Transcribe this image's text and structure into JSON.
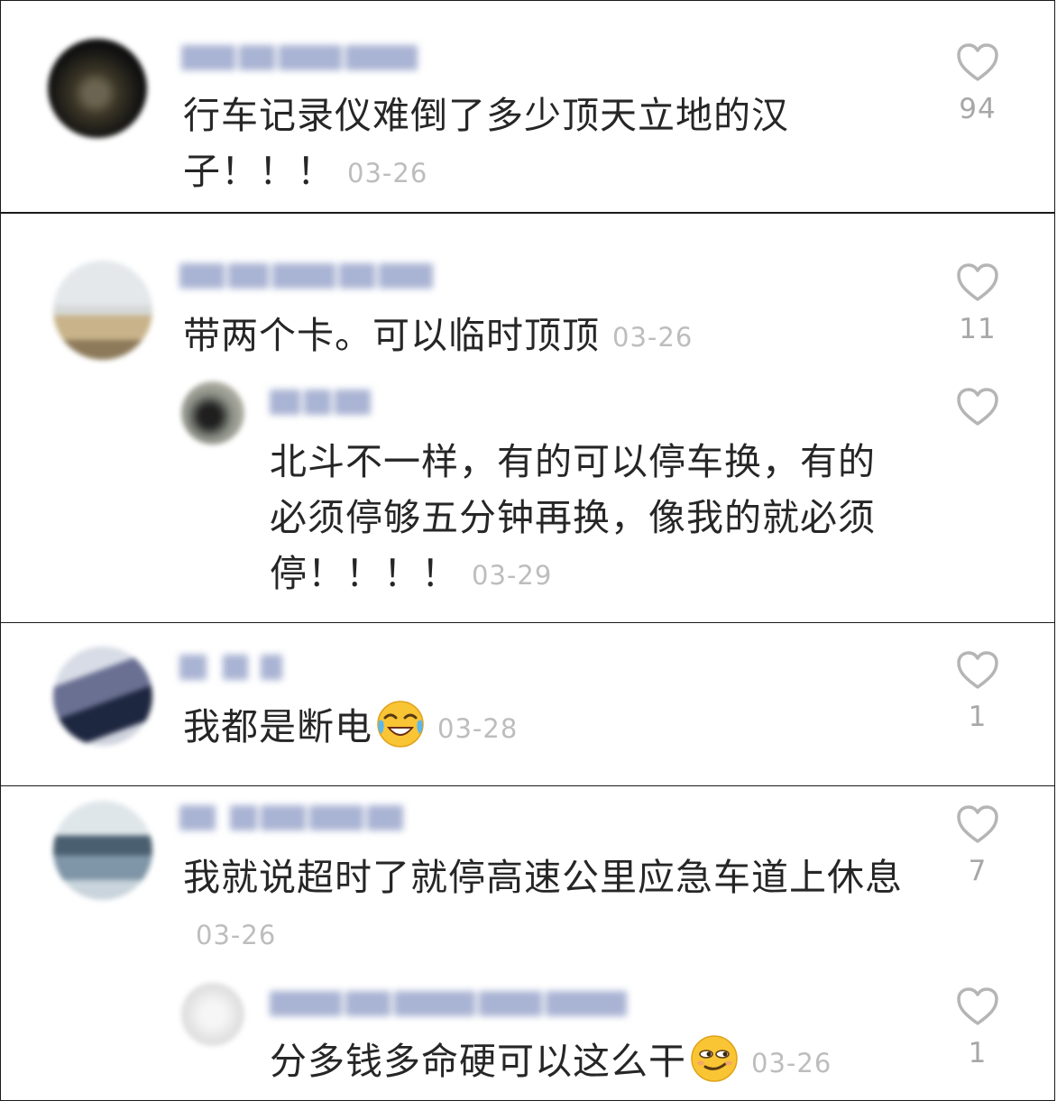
{
  "comments": [
    {
      "text": "行车记录仪难倒了多少顶天立地的汉子！！！",
      "date": "03-26",
      "likes": "94",
      "username_blur": "大眼  通  道",
      "avatar_colors": [
        "#111111",
        "#3a3526",
        "#6b6450"
      ]
    },
    {
      "text": "带两个卡。可以临时顶顶",
      "date": "03-26",
      "likes": "11",
      "username_blur": "东  图  厂  ",
      "avatar_colors": [
        "#d8dde0",
        "#c8b38a",
        "#8c7a5a"
      ],
      "reply": {
        "text": "北斗不一样，有的可以停车换，有的必须停够五分钟再换，像我的就必须停！！！！",
        "date": "03-29",
        "likes": "",
        "username_blur": "38度",
        "avatar_colors": [
          "#8b8f86",
          "#1f1f1f",
          "#b9b7ab"
        ]
      }
    },
    {
      "text": "我都是断电",
      "date": "03-28",
      "likes": "1",
      "emoji": "laughing-crying-emoji",
      "username_blur": "  飞  ",
      "avatar_colors": [
        "#cfd3dd",
        "#6a7092",
        "#1e2740"
      ]
    },
    {
      "text": "我就说超时了就停高速公里应急车道上休息",
      "date": "03-26",
      "likes": "7",
      "username_blur": "清  ",
      "avatar_colors": [
        "#dfe6ea",
        "#4a5f70",
        "#7f96a8"
      ],
      "reply": {
        "text": "分多钱多命硬可以这么干",
        "date": "03-26",
        "likes": "1",
        "emoji": "smirk-emoji",
        "username_blur": "user_1528",
        "avatar_colors": [
          "#efefef",
          "#e4e4e4",
          "#d8d8d8"
        ]
      }
    }
  ]
}
